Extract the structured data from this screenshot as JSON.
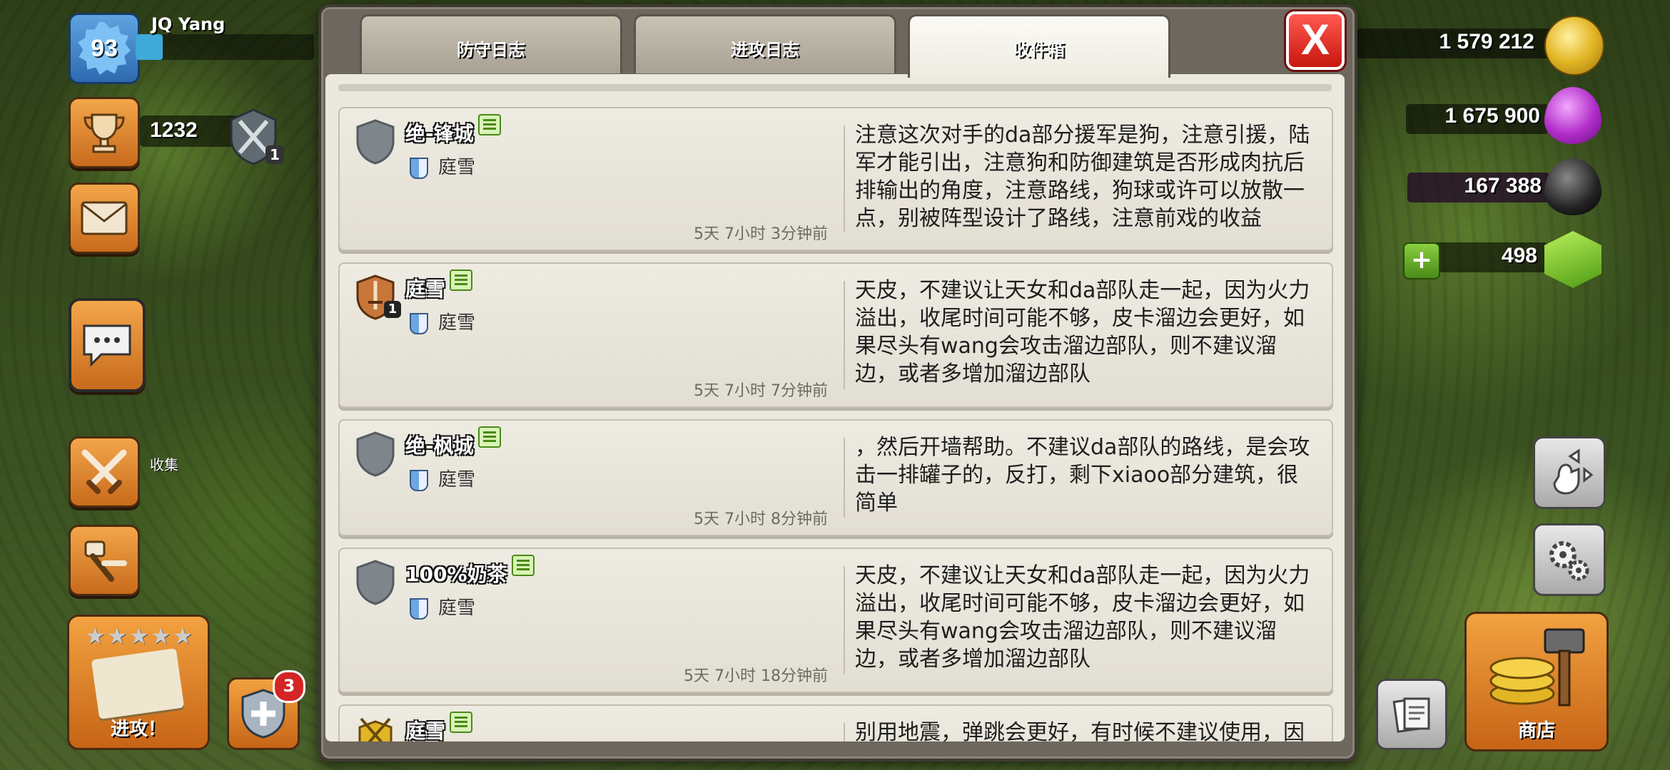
{
  "player": {
    "level": "93",
    "name": "JQ Yang",
    "trophies": "1232",
    "league_rank": "1",
    "xp_progress": 0.15
  },
  "resources": {
    "gold": "1 579 212",
    "elixir": "1 675 900",
    "dark_elixir": "167 388",
    "gems": "498"
  },
  "left_hud": {
    "collect_label": "收集",
    "attack_label": "进攻！",
    "attack_stars": "★★★★★",
    "notification_count": "3"
  },
  "right_hud": {
    "shop_label": "商店"
  },
  "modal": {
    "tabs": [
      {
        "label": "防守日志"
      },
      {
        "label": "进攻日志"
      },
      {
        "label": "收件箱"
      }
    ],
    "active_tab": 2,
    "close_label": "X"
  },
  "messages": [
    {
      "sender": "绝-锋城",
      "clan": "庭雪",
      "time": "5天 7小时 3分钟前",
      "icon": "empty-shield-icon",
      "body": "注意这次对手的da部分援军是狗，注意引援，陆军才能引出，注意狗和防御建筑是否形成肉抗后排输出的角度，注意路线，狗球或许可以放散一点，别被阵型设计了路线，注意前戏的收益"
    },
    {
      "sender": "庭雪",
      "clan": "庭雪",
      "time": "5天 7小时 7分钟前",
      "icon": "bronze-sword-shield-icon",
      "icon_badge": "1",
      "body": "天皮，不建议让天女和da部队走一起，因为火力溢出，收尾时间可能不够，皮卡溜边会更好，如果尽头有wang会攻击溜边部队，则不建议溜边，或者多增加溜边部队"
    },
    {
      "sender": "绝-枫城",
      "clan": "庭雪",
      "time": "5天 7小时 8分钟前",
      "icon": "empty-shield-icon",
      "body": "，然后开墙帮助。不建议da部队的路线，是会攻击一排罐子的，反打，剩下xiaoo部分建筑，很简单"
    },
    {
      "sender": "100%奶茶",
      "clan": "庭雪",
      "time": "5天 7小时 18分钟前",
      "icon": "empty-shield-icon",
      "body": "天皮，不建议让天女和da部队走一起，因为火力溢出，收尾时间可能不够，皮卡溜边会更好，如果尽头有wang会攻击溜边部队，则不建议溜边，或者多增加溜边部队"
    },
    {
      "sender": "庭雪",
      "clan": "",
      "time": "",
      "icon": "gold-crossed-swords-icon",
      "body": "别用地震，弹跳会更好，有时候不建议使用，因"
    }
  ]
}
